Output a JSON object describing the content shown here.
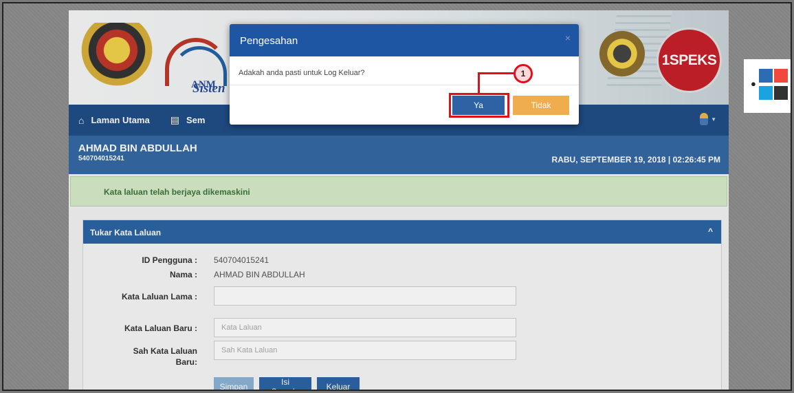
{
  "banner": {
    "anm_text": "ANM",
    "sistem_text": "Sisten",
    "speks_logo": "1SPEKS"
  },
  "navbar": {
    "items": [
      {
        "label": "Laman Utama",
        "icon": "home-icon"
      },
      {
        "label": "Sem",
        "icon": "list-icon"
      }
    ],
    "user_icon": "user-icon"
  },
  "profile": {
    "name": "AHMAD BIN ABDULLAH",
    "id": "540704015241",
    "datetime": "RABU, SEPTEMBER 19, 2018 | 02:26:45 PM"
  },
  "alert": {
    "message": "Kata laluan telah berjaya dikemaskini"
  },
  "panel": {
    "title": "Tukar Kata Laluan",
    "toggle": "^",
    "fields": {
      "id_label": "ID Pengguna :",
      "id_value": "540704015241",
      "nama_label": "Nama :",
      "nama_value": "AHMAD BIN ABDULLAH",
      "lama_label": "Kata Laluan Lama :",
      "baru_label": "Kata Laluan Baru :",
      "baru_placeholder": "Kata Laluan",
      "sah_label_1": "Sah Kata Laluan",
      "sah_label_2": "Baru:",
      "sah_placeholder": "Sah Kata Laluan"
    },
    "buttons": {
      "simpan": "Simpan",
      "isi_semula": "Isi Semula",
      "keluar": "Keluar"
    }
  },
  "modal": {
    "title": "Pengesahan",
    "close": "×",
    "message": "Adakah anda pasti untuk Log Keluar?",
    "confirm": "Ya",
    "cancel": "Tidak"
  },
  "annotation": {
    "step": "1",
    "color": "#e0101b"
  },
  "color_widget": {
    "icon": "drop-icon",
    "swatches": [
      "#2d6bb3",
      "#f04a3e",
      "#1aa3e0",
      "#333333"
    ]
  }
}
